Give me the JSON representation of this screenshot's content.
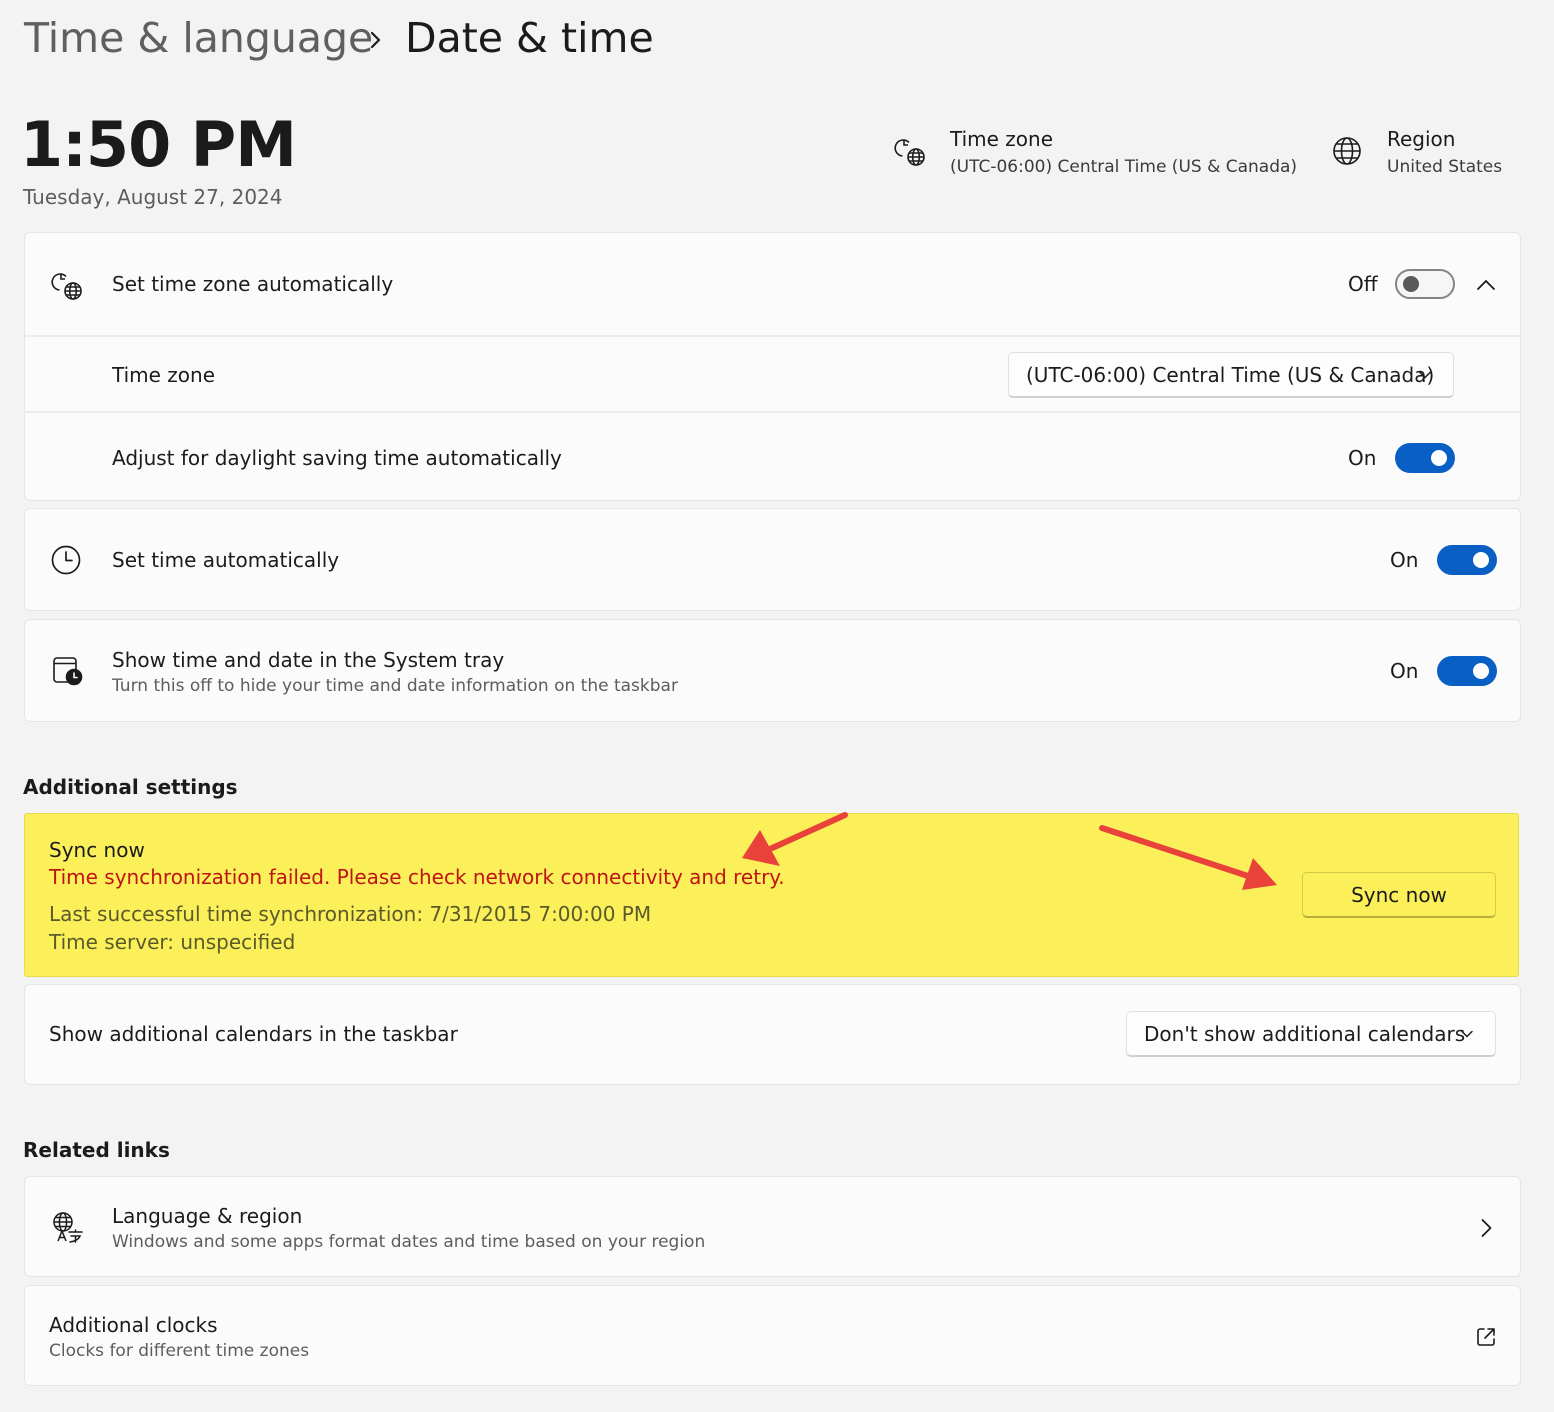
{
  "breadcrumb": {
    "parent": "Time & language",
    "separator_icon": "chevron-right-icon",
    "current": "Date & time"
  },
  "clock": {
    "time": "1:50 PM",
    "date": "Tuesday, August 27, 2024"
  },
  "header_info": {
    "timezone": {
      "icon": "clock-globe-icon",
      "title": "Time zone",
      "value": "(UTC-06:00) Central Time (US & Canada)"
    },
    "region": {
      "icon": "globe-icon",
      "title": "Region",
      "value": "United States"
    }
  },
  "settings": {
    "set_timezone_auto": {
      "icon": "clock-globe-icon",
      "label": "Set time zone automatically",
      "state": "Off",
      "toggle_on": false,
      "expand_icon": "chevron-up-icon"
    },
    "timezone": {
      "label": "Time zone",
      "selected": "(UTC-06:00) Central Time (US & Canada)",
      "dropdown_icon": "chevron-down-icon"
    },
    "daylight_saving": {
      "label": "Adjust for daylight saving time automatically",
      "state": "On",
      "toggle_on": true
    },
    "set_time_auto": {
      "icon": "clock-icon",
      "label": "Set time automatically",
      "state": "On",
      "toggle_on": true
    },
    "show_in_tray": {
      "icon": "calendar-clock-icon",
      "label": "Show time and date in the System tray",
      "description": "Turn this off to hide your time and date information on the taskbar",
      "state": "On",
      "toggle_on": true
    }
  },
  "additional_settings": {
    "title": "Additional settings",
    "sync": {
      "title": "Sync now",
      "error": "Time synchronization failed. Please check network connectivity and retry.",
      "last_sync": "Last successful time synchronization: 7/31/2015 7:00:00 PM",
      "time_server": "Time server: unspecified",
      "button_label": "Sync now",
      "highlight_color": "#fbf05a",
      "error_color": "#c01414",
      "annotation_arrow_color": "#e8423a"
    },
    "calendars": {
      "label": "Show additional calendars in the taskbar",
      "selected": "Don't show additional calendars",
      "dropdown_icon": "chevron-down-icon"
    }
  },
  "related_links": {
    "title": "Related links",
    "language_region": {
      "icon": "language-icon",
      "title": "Language & region",
      "description": "Windows and some apps format dates and time based on your region",
      "action_icon": "chevron-right-icon"
    },
    "additional_clocks": {
      "title": "Additional clocks",
      "description": "Clocks for different time zones",
      "action_icon": "external-link-icon"
    }
  },
  "colors": {
    "accent": "#0a5fc4",
    "background": "#f3f3f3",
    "card": "#fbfbfb"
  }
}
